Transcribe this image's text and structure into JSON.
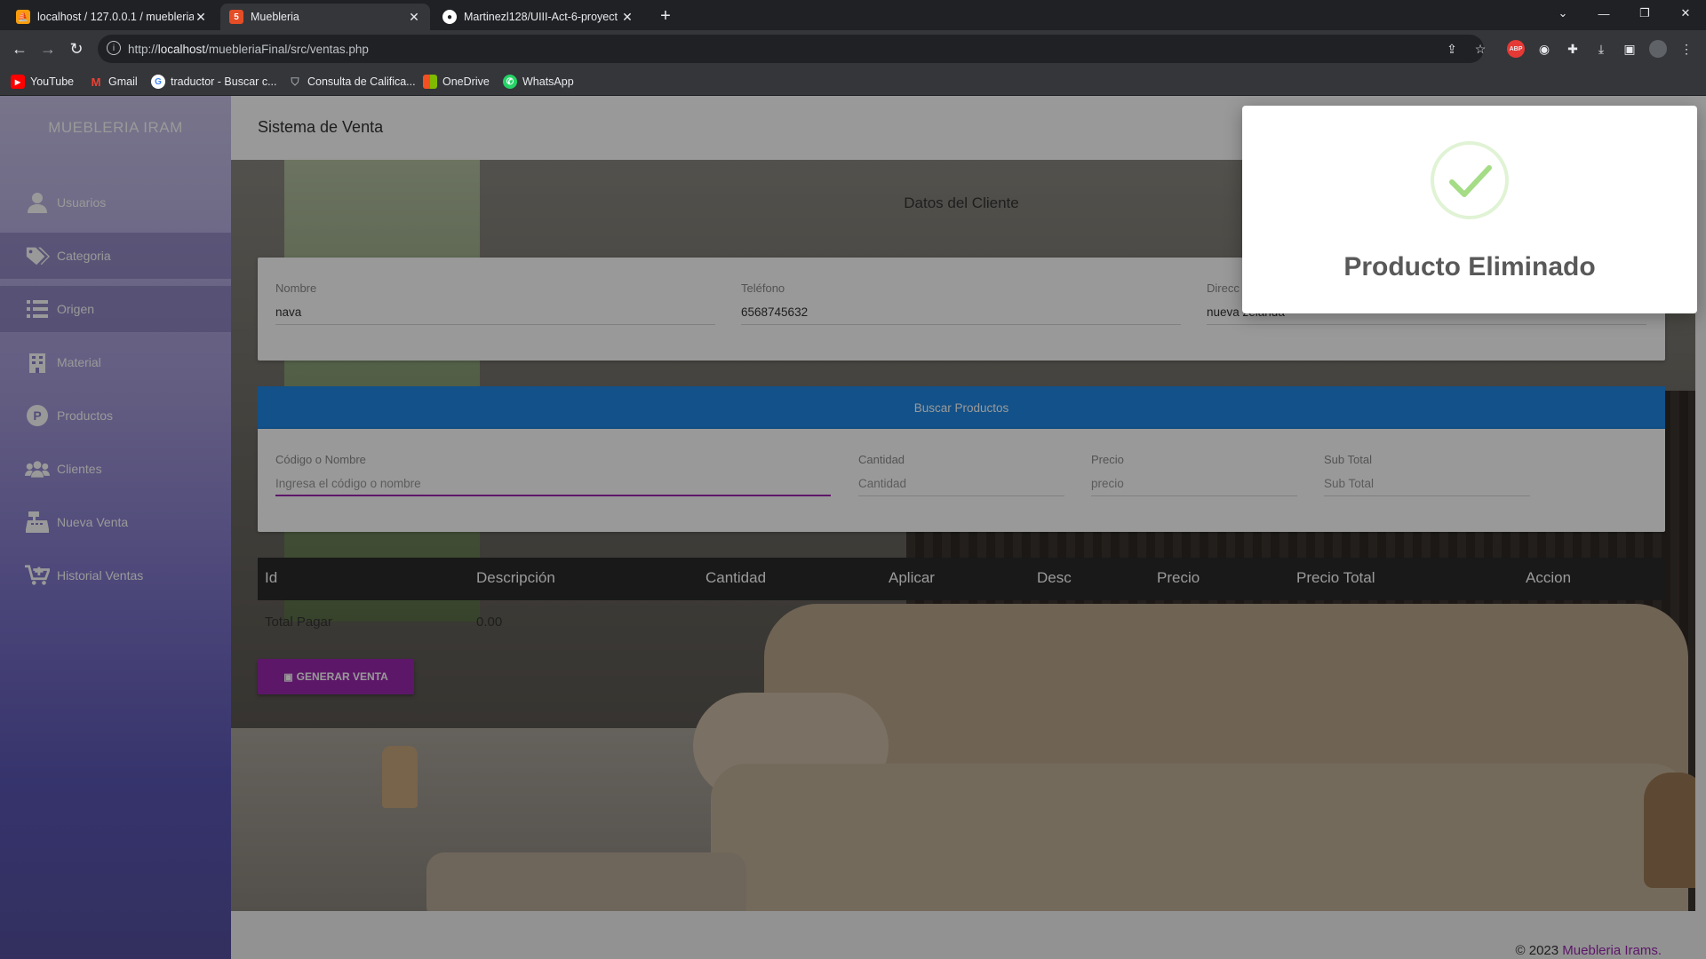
{
  "browser": {
    "tabs": [
      {
        "title": "localhost / 127.0.0.1 / muebleria",
        "icon": "phpmyadmin-icon"
      },
      {
        "title": "Muebleria",
        "icon": "html5-icon"
      },
      {
        "title": "Martinezl128/UIII-Act-6-proyect",
        "icon": "github-icon"
      }
    ],
    "url_prefix": "http://",
    "url_host": "localhost",
    "url_path": "/muebleriaFinal/src/ventas.php",
    "bookmarks": [
      "YouTube",
      "Gmail",
      "traductor - Buscar c...",
      "Consulta de Califica...",
      "OneDrive",
      "WhatsApp"
    ]
  },
  "sidebar": {
    "brand": "MUEBLERIA IRAM",
    "items": [
      {
        "label": "Usuarios",
        "icon": "user-icon"
      },
      {
        "label": "Categoria",
        "icon": "tags-icon"
      },
      {
        "label": "Origen",
        "icon": "list-icon"
      },
      {
        "label": "Material",
        "icon": "building-icon"
      },
      {
        "label": "Productos",
        "icon": "product-p-icon"
      },
      {
        "label": "Clientes",
        "icon": "users-icon"
      },
      {
        "label": "Nueva Venta",
        "icon": "cash-register-icon"
      },
      {
        "label": "Historial Ventas",
        "icon": "cart-plus-icon"
      }
    ]
  },
  "main": {
    "header_title": "Sistema de Venta",
    "cliente": {
      "section_title": "Datos del Cliente",
      "nombre_label": "Nombre",
      "nombre_value": "nava",
      "telefono_label": "Teléfono",
      "telefono_value": "6568745632",
      "direccion_label": "Direcc",
      "direccion_value": "nueva zelanda"
    },
    "buscar": {
      "section_title": "Buscar Productos",
      "codigo_label": "Código o Nombre",
      "codigo_placeholder": "Ingresa el código o nombre",
      "cantidad_label": "Cantidad",
      "cantidad_placeholder": "Cantidad",
      "precio_label": "Precio",
      "precio_placeholder": "precio",
      "subtotal_label": "Sub Total",
      "subtotal_placeholder": "Sub Total"
    },
    "table": {
      "columns": [
        "Id",
        "Descripción",
        "Cantidad",
        "Aplicar",
        "Desc",
        "Precio",
        "Precio Total",
        "Accion"
      ],
      "total_label": "Total Pagar",
      "total_value": "0.00"
    },
    "generate_button": "GENERAR VENTA",
    "footer_prefix": "© 2023 ",
    "footer_link": "Muebleria Irams."
  },
  "alert": {
    "message": "Producto Eliminado",
    "icon": "success-check-icon"
  },
  "colors": {
    "accent": "#9c27b0",
    "header_blue": "#1e88e5",
    "success": "#a5dc86"
  }
}
